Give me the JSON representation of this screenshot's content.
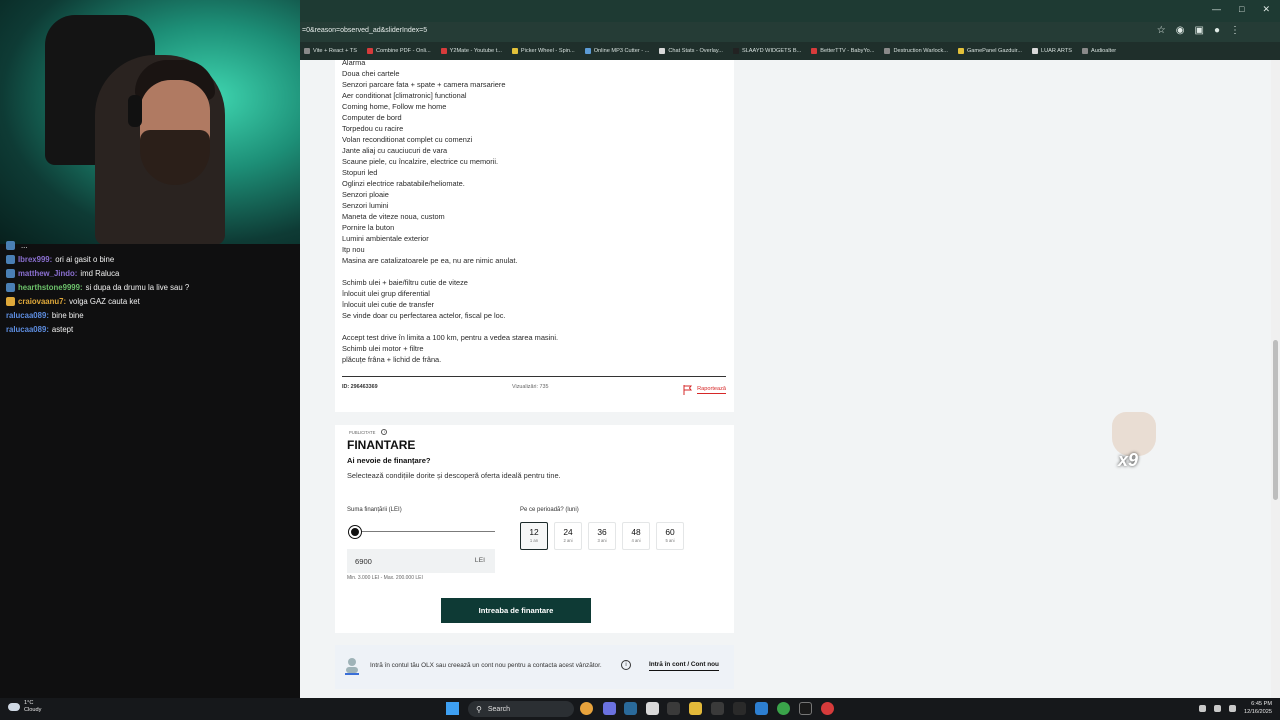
{
  "browser": {
    "url": "=0&reason=observed_ad&sliderIndex=5",
    "bookmarks": [
      {
        "label": "Vite + React + TS",
        "color": "#8a8a8a"
      },
      {
        "label": "Combine PDF - Onli...",
        "color": "#d63b3b"
      },
      {
        "label": "Y2Mate - Youtube t...",
        "color": "#d63b3b"
      },
      {
        "label": "Picker Wheel - Spin...",
        "color": "#e2c13a"
      },
      {
        "label": "Online MP3 Cutter - ...",
        "color": "#5c9bd6"
      },
      {
        "label": "Chat Stats - Overlay...",
        "color": "#d9d9d9"
      },
      {
        "label": "SLAAYD WIDGETS B...",
        "color": "#222222"
      },
      {
        "label": "BetterTTV - BabyYo...",
        "color": "#d63b3b"
      },
      {
        "label": "Destruction Warlock...",
        "color": "#8a8a8a"
      },
      {
        "label": "GamePanel Gazduir...",
        "color": "#e2c13a"
      },
      {
        "label": "LUAR ARTS",
        "color": "#d9d9d9"
      },
      {
        "label": "Audioalter",
        "color": "#8a8a8a"
      }
    ]
  },
  "description": {
    "lines": [
      "Alarma",
      "Doua chei cartele",
      "Senzori parcare fata + spate + camera marsariere",
      "Aer conditionat [climatronic] functional",
      "Coming home, Follow me home",
      "Computer de bord",
      "Torpedou cu racire",
      "Volan reconditionat complet cu comenzi",
      "Jante aliaj cu cauciucuri de vara",
      "Scaune piele, cu încalzire, electrice cu memorii.",
      "Stopuri led",
      "Oglinzi electrice rabatabile/heliomate.",
      "Senzori ploaie",
      "Senzori lumini",
      "Maneta de viteze noua, custom",
      "Pornire la buton",
      "Lumini ambientale exterior",
      "Itp nou",
      "Masina are catalizatoarele pe ea, nu are nimic anulat.",
      "",
      "Schimb ulei + baie/filtru cutie de viteze",
      "înlocuit ulei grup diferential",
      "înlocuit ulei cutie de transfer",
      "Se vinde doar cu perfectarea actelor, fiscal pe loc.",
      "",
      "Accept test drive în limita a 100 km, pentru a vedea starea masini.",
      "Schimb ulei motor + filtre",
      "plăcuțe frâna + lichid de frâna."
    ],
    "ad_id": "ID: 296463369",
    "views": "Vizualizări: 735",
    "report_label": "Raportează"
  },
  "financing": {
    "sponsored_label": "PUBLICITATE",
    "title": "FINANTARE",
    "subtitle": "Ai nevoie de finanțare?",
    "description": "Selectează condițiile dorite și descoperă oferta ideală pentru tine.",
    "amount_label": "Suma finanțării (LEI)",
    "slider_fraction": 0.0,
    "amount_value": "6900",
    "amount_unit": "LEI",
    "amount_range": "Min. 3.000 LEI - Max. 200.000 LEI",
    "period_label": "Pe ce perioadă? (luni)",
    "periods": [
      {
        "months": "12",
        "years": "1 an",
        "selected": true
      },
      {
        "months": "24",
        "years": "2 ani",
        "selected": false
      },
      {
        "months": "36",
        "years": "3 ani",
        "selected": false
      },
      {
        "months": "48",
        "years": "4 ani",
        "selected": false
      },
      {
        "months": "60",
        "years": "5 ani",
        "selected": false
      }
    ],
    "cta_label": "Intreaba de finantare"
  },
  "login_banner": {
    "text": "Intră în contul tău OLX sau creează un cont nou pentru a contacta acest vânzător.",
    "link_label": "Intră în cont / Cont nou"
  },
  "chat": {
    "messages": [
      {
        "user": "",
        "text": "...",
        "color": "#9a9a9a"
      },
      {
        "user": "Ibrex999:",
        "text": "ori ai gasit o bine",
        "color": "#8a6fd0"
      },
      {
        "user": "matthew_Jindo:",
        "text": "imd Raluca",
        "color": "#8a6fd0"
      },
      {
        "user": "hearthstone9999:",
        "text": "si dupa da drumu la live sau ?",
        "color": "#6cc16a"
      },
      {
        "user": "craiovaanu7:",
        "text": "volga GAZ cauta ket",
        "color": "#e0a93a"
      },
      {
        "user": "ralucaa089:",
        "text": "bine bine",
        "color": "#5d8de0"
      },
      {
        "user": "ralucaa089:",
        "text": "astept",
        "color": "#5d8de0"
      }
    ]
  },
  "sticker": {
    "label": "x9"
  },
  "taskbar": {
    "weather_temp": "1°C",
    "weather_desc": "Cloudy",
    "search_label": "Search",
    "time": "6:45 PM",
    "date": "12/16/2025"
  }
}
